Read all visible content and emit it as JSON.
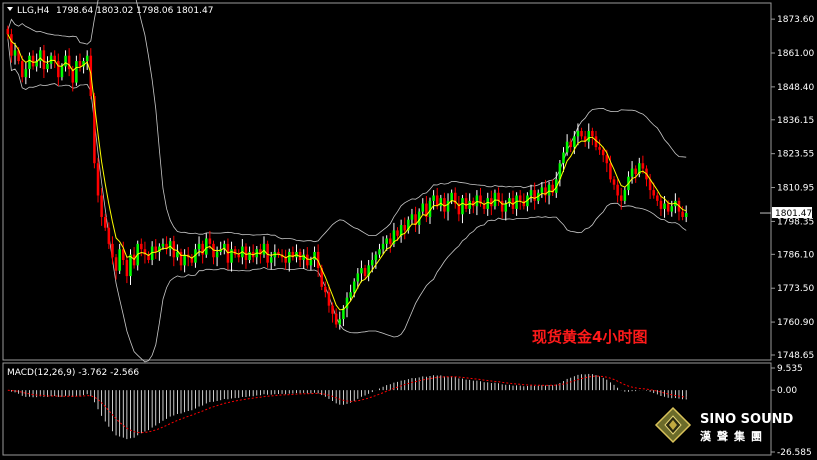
{
  "header": {
    "symbol": "LLG,H4",
    "ohlc": "1798.64 1803.02 1798.06 1801.47"
  },
  "annotation": "现货黄金4小时图",
  "brand": {
    "name_en": "SINO SOUND",
    "name_cn": "漢聲集團",
    "logo_icon": "diamond-logo-icon"
  },
  "colors": {
    "bull": "#ffffff",
    "bear": "#ff0000",
    "up_candle": "#00ff00",
    "ma": "#ffff00",
    "band": "#c8c8c8",
    "macd_hist": "#ffffff",
    "macd_signal": "#ff0000",
    "price_box": "#ffffff"
  },
  "chart_data": [
    {
      "type": "candlestick",
      "instrument": "LLG",
      "timeframe": "H4",
      "overlays": [
        "moving-average",
        "bollinger-bands"
      ],
      "current_price": 1801.47,
      "current_price_label": "1801.47",
      "y_ticks": [
        "1873.60",
        "1861.00",
        "1848.40",
        "1836.15",
        "1823.55",
        "1810.95",
        "1798.35",
        "1786.10",
        "1773.50",
        "1760.90",
        "1748.65"
      ],
      "ylim": [
        1748.65,
        1877.0
      ],
      "closes": [
        1868,
        1860,
        1862,
        1858,
        1852,
        1855,
        1860,
        1856,
        1858,
        1862,
        1855,
        1857,
        1860,
        1858,
        1852,
        1856,
        1860,
        1855,
        1850,
        1858,
        1856,
        1858,
        1860,
        1845,
        1820,
        1808,
        1800,
        1796,
        1790,
        1785,
        1780,
        1788,
        1784,
        1778,
        1786,
        1782,
        1790,
        1788,
        1786,
        1784,
        1789,
        1787,
        1789,
        1790,
        1788,
        1791,
        1785,
        1787,
        1782,
        1786,
        1785,
        1783,
        1788,
        1790,
        1786,
        1792,
        1790,
        1785,
        1787,
        1788,
        1790,
        1783,
        1788,
        1786,
        1785,
        1789,
        1784,
        1787,
        1785,
        1788,
        1786,
        1790,
        1783,
        1785,
        1787,
        1786,
        1785,
        1783,
        1787,
        1785,
        1787,
        1784,
        1786,
        1782,
        1784,
        1787,
        1781,
        1774,
        1772,
        1767,
        1764,
        1760,
        1762,
        1766,
        1770,
        1772,
        1776,
        1779,
        1781,
        1778,
        1782,
        1784,
        1786,
        1788,
        1790,
        1792,
        1790,
        1795,
        1793,
        1797,
        1795,
        1799,
        1801,
        1797,
        1802,
        1805,
        1800,
        1806,
        1808,
        1804,
        1807,
        1802,
        1806,
        1809,
        1805,
        1801,
        1807,
        1803,
        1806,
        1804,
        1808,
        1805,
        1803,
        1807,
        1804,
        1809,
        1806,
        1802,
        1805,
        1807,
        1803,
        1808,
        1806,
        1804,
        1808,
        1810,
        1806,
        1809,
        1811,
        1808,
        1812,
        1809,
        1814,
        1820,
        1824,
        1828,
        1826,
        1830,
        1832,
        1830,
        1828,
        1832,
        1830,
        1826,
        1825,
        1823,
        1820,
        1814,
        1812,
        1808,
        1806,
        1810,
        1815,
        1818,
        1816,
        1820,
        1818,
        1814,
        1810,
        1808,
        1806,
        1803,
        1805,
        1802,
        1804,
        1806,
        1802,
        1800,
        1801.47
      ],
      "macd": {
        "label": "MACD(12,26,9) -3.762 -2.566",
        "params": [
          12,
          26,
          9
        ],
        "macd_value": -3.762,
        "signal_value": -2.566,
        "y_ticks": [
          "9.535",
          "0.00",
          "-26.585"
        ],
        "ylim": [
          -26.585,
          9.535
        ]
      }
    }
  ]
}
